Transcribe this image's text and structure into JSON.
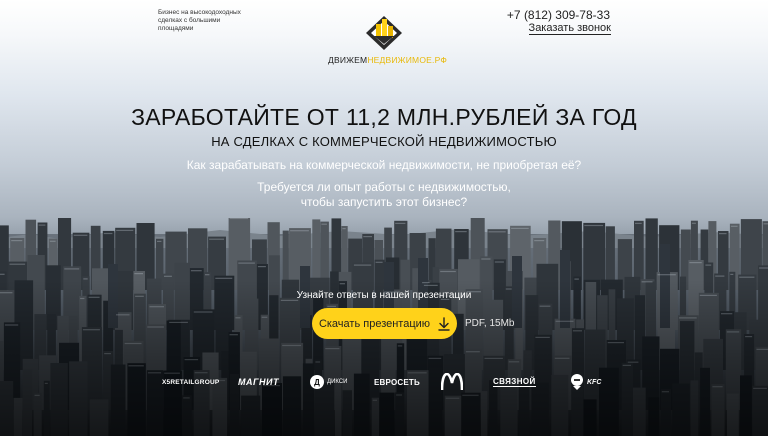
{
  "header": {
    "tagline": "Бизнес на высокодоходных сделках с большими площадями",
    "logo": {
      "name_dark": "ДВИЖЕМ",
      "name_accent": "НЕДВИЖИМОЕ.РФ"
    },
    "phone": "+7 (812) 309-78-33",
    "callback_label": "Заказать звонок"
  },
  "hero": {
    "headline": "ЗАРАБОТАЙТЕ ОТ 11,2 МЛН.РУБЛЕЙ ЗА ГОД",
    "subheadline": "НА СДЕЛКАХ С КОММЕРЧЕСКОЙ НЕДВИЖИМОСТЬЮ",
    "question_1": "Как зарабатывать на коммерческой недвижимости, не приобретая её?",
    "question_2_line1": "Требуется ли опыт работы с недвижимостью,",
    "question_2_line2": "чтобы запустить этот бизнес?"
  },
  "cta": {
    "label": "Узнайте ответы в нашей презентации",
    "button_label": "Скачать презентацию",
    "button_icon": "download-arrow-icon",
    "meta": "PDF, 15Mb"
  },
  "partners": [
    {
      "name": "X5 RETAIL GROUP",
      "text": "X5RETAILGROUP"
    },
    {
      "name": "Магнит",
      "text": "МАГНИТ"
    },
    {
      "name": "Дикси",
      "text": "ДИКСИ",
      "badge": "Д"
    },
    {
      "name": "Евросеть",
      "text": "ЕВРОСЕТЬ"
    },
    {
      "name": "McDonald's",
      "text": "M"
    },
    {
      "name": "Связной",
      "text": "СВЯЗНОЙ"
    },
    {
      "name": "KFC",
      "text": "KFC"
    }
  ],
  "colors": {
    "accent": "#ffd21a",
    "logo_accent": "#e8b90a",
    "text_dark": "#111111",
    "text_light": "#ffffff"
  }
}
